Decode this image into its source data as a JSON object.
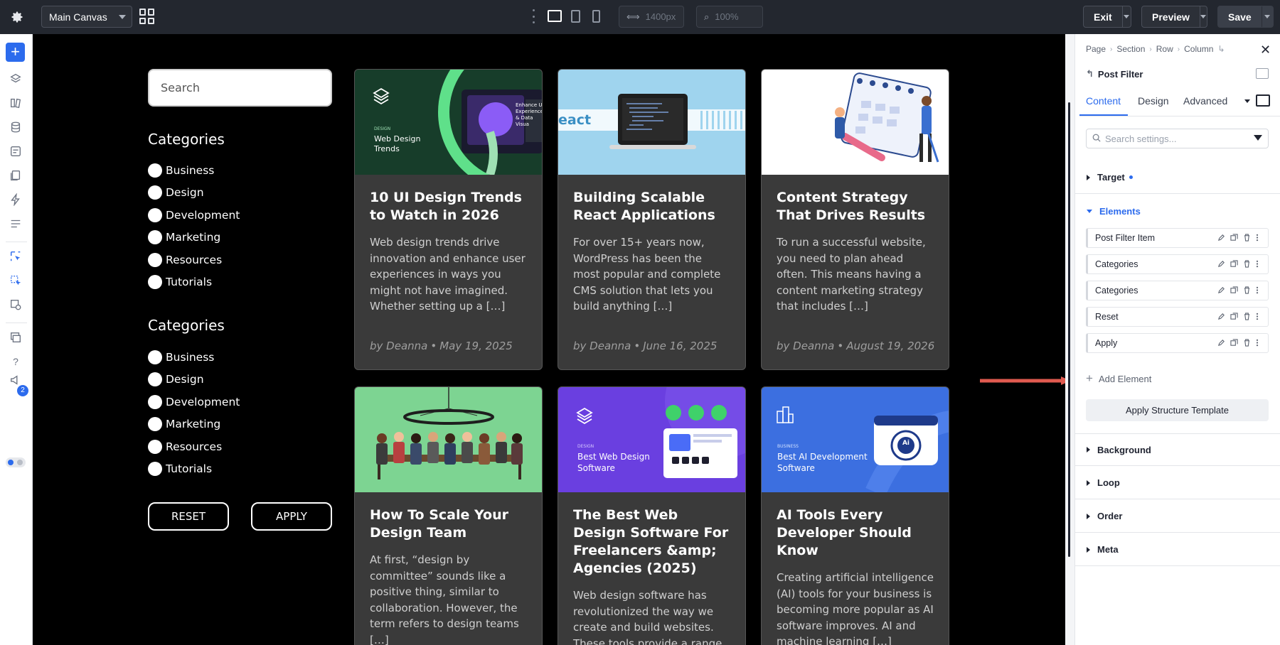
{
  "topbar": {
    "canvas_select": "Main Canvas",
    "width_value": "1400px",
    "zoom_value": "100%",
    "exit_label": "Exit",
    "preview_label": "Preview",
    "save_label": "Save"
  },
  "rail": {
    "notification_count": "2"
  },
  "filter": {
    "search_placeholder": "Search",
    "groups": [
      {
        "title": "Categories",
        "items": [
          "Business",
          "Design",
          "Development",
          "Marketing",
          "Resources",
          "Tutorials"
        ]
      },
      {
        "title": "Categories",
        "items": [
          "Business",
          "Design",
          "Development",
          "Marketing",
          "Resources",
          "Tutorials"
        ]
      }
    ],
    "reset_label": "RESET",
    "apply_label": "APPLY"
  },
  "posts": [
    {
      "title": "10 UI Design Trends to Watch in 2026",
      "excerpt": "Web design trends drive innovation and enhance user experiences in ways you might not have imagined. Whether setting up a […]",
      "author": "by Deanna",
      "date": "May 19, 2025",
      "image_label": "Web Design Trends",
      "image_tag": "DESIGN",
      "image_side": "Enhance Ui Experience & Data Visua"
    },
    {
      "title": "Building Scalable React Applications",
      "excerpt": "For over 15+ years now, WordPress has been the most popular and complete CMS solution that lets you build anything […]",
      "author": "by Deanna",
      "date": "June 16, 2025",
      "image_label": "eact"
    },
    {
      "title": "Content Strategy That Drives Results",
      "excerpt": "To run a successful website, you need to plan ahead often. This means having a content marketing strategy that includes […]",
      "author": "by Deanna",
      "date": "August 19, 2026"
    },
    {
      "title": "How To Scale Your Design Team",
      "excerpt": "At first, “design by committee” sounds like a positive thing, similar to collaboration. However, the term refers to design teams […]"
    },
    {
      "title": "The Best Web Design Software For Freelancers &amp; Agencies (2025)",
      "excerpt": "Web design software has revolutionized the way we create and build websites. These tools provide a range of",
      "image_label": "Best Web Design Software",
      "image_tag": "DESIGN"
    },
    {
      "title": "AI Tools Every Developer Should Know",
      "excerpt": "Creating artificial intelligence (AI) tools for your business is becoming more popular as AI software improves. AI and machine learning […]",
      "image_label": "Best AI Development Software",
      "image_tag": "BUSINESS"
    }
  ],
  "panel": {
    "breadcrumb": [
      "Page",
      "Section",
      "Row",
      "Column"
    ],
    "module_title": "Post Filter",
    "tabs": [
      "Content",
      "Design",
      "Advanced"
    ],
    "search_placeholder": "Search settings...",
    "target_label": "Target",
    "elements_label": "Elements",
    "elements": [
      "Post Filter Item",
      "Categories",
      "Categories",
      "Reset",
      "Apply"
    ],
    "add_element_label": "Add Element",
    "structure_button": "Apply Structure Template",
    "sections": [
      "Background",
      "Loop",
      "Order",
      "Meta"
    ]
  },
  "colors": {
    "accent": "#2c6bed",
    "annotation_arrow": "#e05a4f",
    "canvas_bg": "#000000",
    "card_bg": "#3a3a3a"
  }
}
